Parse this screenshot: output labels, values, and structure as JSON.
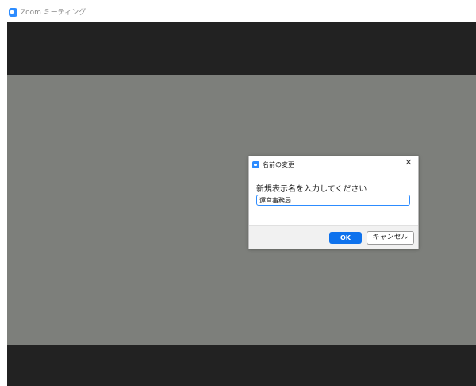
{
  "window": {
    "title": "Zoom ミーティング"
  },
  "dialog": {
    "title": "名前の変更",
    "close_label": "✕",
    "prompt": "新規表示名を入力してください",
    "input_value": "運営事務局",
    "ok_label": "OK",
    "cancel_label": "キャンセル"
  },
  "colors": {
    "accent": "#2d8cff",
    "ok_button": "#0e72ed",
    "video_bg": "#7d7f7b",
    "dark_bg": "#222222"
  },
  "icons": {
    "app": "zoom-logo-icon",
    "dialog": "zoom-logo-icon",
    "close": "close-icon"
  }
}
